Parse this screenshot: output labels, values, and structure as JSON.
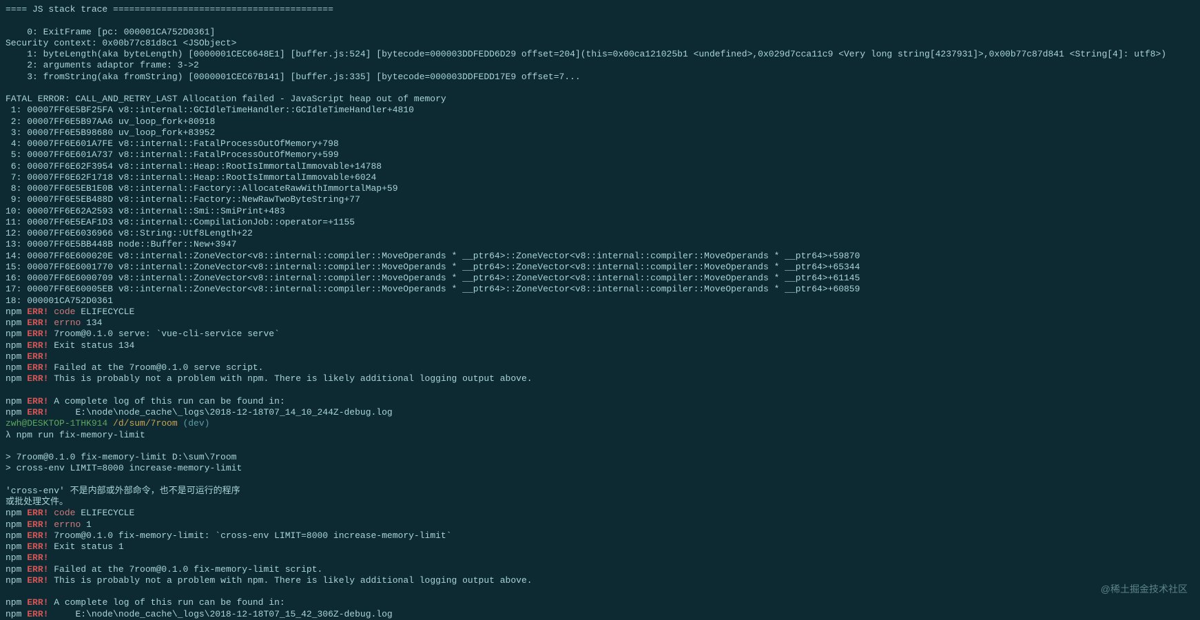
{
  "trace_header": "==== JS stack trace =========================================",
  "blank": "",
  "stack": [
    "    0: ExitFrame [pc: 000001CA752D0361]",
    "Security context: 0x00b77c81d8c1 <JSObject>",
    "    1: byteLength(aka byteLength) [0000001CEC6648E1] [buffer.js:524] [bytecode=000003DDFEDD6D29 offset=204](this=0x00ca121025b1 <undefined>,0x029d7cca11c9 <Very long string[4237931]>,0x00b77c87d841 <String[4]: utf8>)",
    "    2: arguments adaptor frame: 3->2",
    "    3: fromString(aka fromString) [0000001CEC67B141] [buffer.js:335] [bytecode=000003DDFEDD17E9 offset=7..."
  ],
  "fatal": "FATAL ERROR: CALL_AND_RETRY_LAST Allocation failed - JavaScript heap out of memory",
  "native": [
    " 1: 00007FF6E5BF25FA v8::internal::GCIdleTimeHandler::GCIdleTimeHandler+4810",
    " 2: 00007FF6E5B97AA6 uv_loop_fork+80918",
    " 3: 00007FF6E5B98680 uv_loop_fork+83952",
    " 4: 00007FF6E601A7FE v8::internal::FatalProcessOutOfMemory+798",
    " 5: 00007FF6E601A737 v8::internal::FatalProcessOutOfMemory+599",
    " 6: 00007FF6E62F3954 v8::internal::Heap::RootIsImmortalImmovable+14788",
    " 7: 00007FF6E62F1718 v8::internal::Heap::RootIsImmortalImmovable+6024",
    " 8: 00007FF6E5EB1E0B v8::internal::Factory::AllocateRawWithImmortalMap+59",
    " 9: 00007FF6E5EB488D v8::internal::Factory::NewRawTwoByteString+77",
    "10: 00007FF6E62A2593 v8::internal::Smi::SmiPrint+483",
    "11: 00007FF6E5EAF1D3 v8::internal::CompilationJob::operator=+1155",
    "12: 00007FF6E6036966 v8::String::Utf8Length+22",
    "13: 00007FF6E5BB448B node::Buffer::New+3947",
    "14: 00007FF6E600020E v8::internal::ZoneVector<v8::internal::compiler::MoveOperands * __ptr64>::ZoneVector<v8::internal::compiler::MoveOperands * __ptr64>+59870",
    "15: 00007FF6E6001770 v8::internal::ZoneVector<v8::internal::compiler::MoveOperands * __ptr64>::ZoneVector<v8::internal::compiler::MoveOperands * __ptr64>+65344",
    "16: 00007FF6E6000709 v8::internal::ZoneVector<v8::internal::compiler::MoveOperands * __ptr64>::ZoneVector<v8::internal::compiler::MoveOperands * __ptr64>+61145",
    "17: 00007FF6E60005EB v8::internal::ZoneVector<v8::internal::compiler::MoveOperands * __ptr64>::ZoneVector<v8::internal::compiler::MoveOperands * __ptr64>+60859",
    "18: 000001CA752D0361"
  ],
  "npm1": [
    {
      "code": "code",
      "msg": "ELIFECYCLE"
    },
    {
      "code": "errno",
      "msg": "134"
    },
    {
      "code": "",
      "msg": "7room@0.1.0 serve: `vue-cli-service serve`"
    },
    {
      "code": "",
      "msg": "Exit status 134"
    },
    {
      "code": "",
      "msg": ""
    },
    {
      "code": "",
      "msg": "Failed at the 7room@0.1.0 serve script."
    },
    {
      "code": "",
      "msg": "This is probably not a problem with npm. There is likely additional logging output above."
    }
  ],
  "npm1log": [
    "A complete log of this run can be found in:",
    "    E:\\node\\node_cache\\_logs\\2018-12-18T07_14_10_244Z-debug.log"
  ],
  "prompt": {
    "user": "zwh@DESKTOP-1THK914",
    "path": " /d/sum/7room ",
    "branch": "(dev)"
  },
  "cmd": "λ npm run fix-memory-limit",
  "run": [
    "> 7room@0.1.0 fix-memory-limit D:\\sum\\7room",
    "> cross-env LIMIT=8000 increase-memory-limit"
  ],
  "cn": [
    "'cross-env' 不是内部或外部命令，也不是可运行的程序",
    "或批处理文件。"
  ],
  "npm2": [
    {
      "code": "code",
      "msg": "ELIFECYCLE"
    },
    {
      "code": "errno",
      "msg": "1"
    },
    {
      "code": "",
      "msg": "7room@0.1.0 fix-memory-limit: `cross-env LIMIT=8000 increase-memory-limit`"
    },
    {
      "code": "",
      "msg": "Exit status 1"
    },
    {
      "code": "",
      "msg": ""
    },
    {
      "code": "",
      "msg": "Failed at the 7room@0.1.0 fix-memory-limit script."
    },
    {
      "code": "",
      "msg": "This is probably not a problem with npm. There is likely additional logging output above."
    }
  ],
  "npm2log": [
    "A complete log of this run can be found in:",
    "    E:\\node\\node_cache\\_logs\\2018-12-18T07_15_42_306Z-debug.log"
  ],
  "watermark": "@稀土掘金技术社区",
  "tokens": {
    "npm": "npm ",
    "err": "ERR! "
  }
}
